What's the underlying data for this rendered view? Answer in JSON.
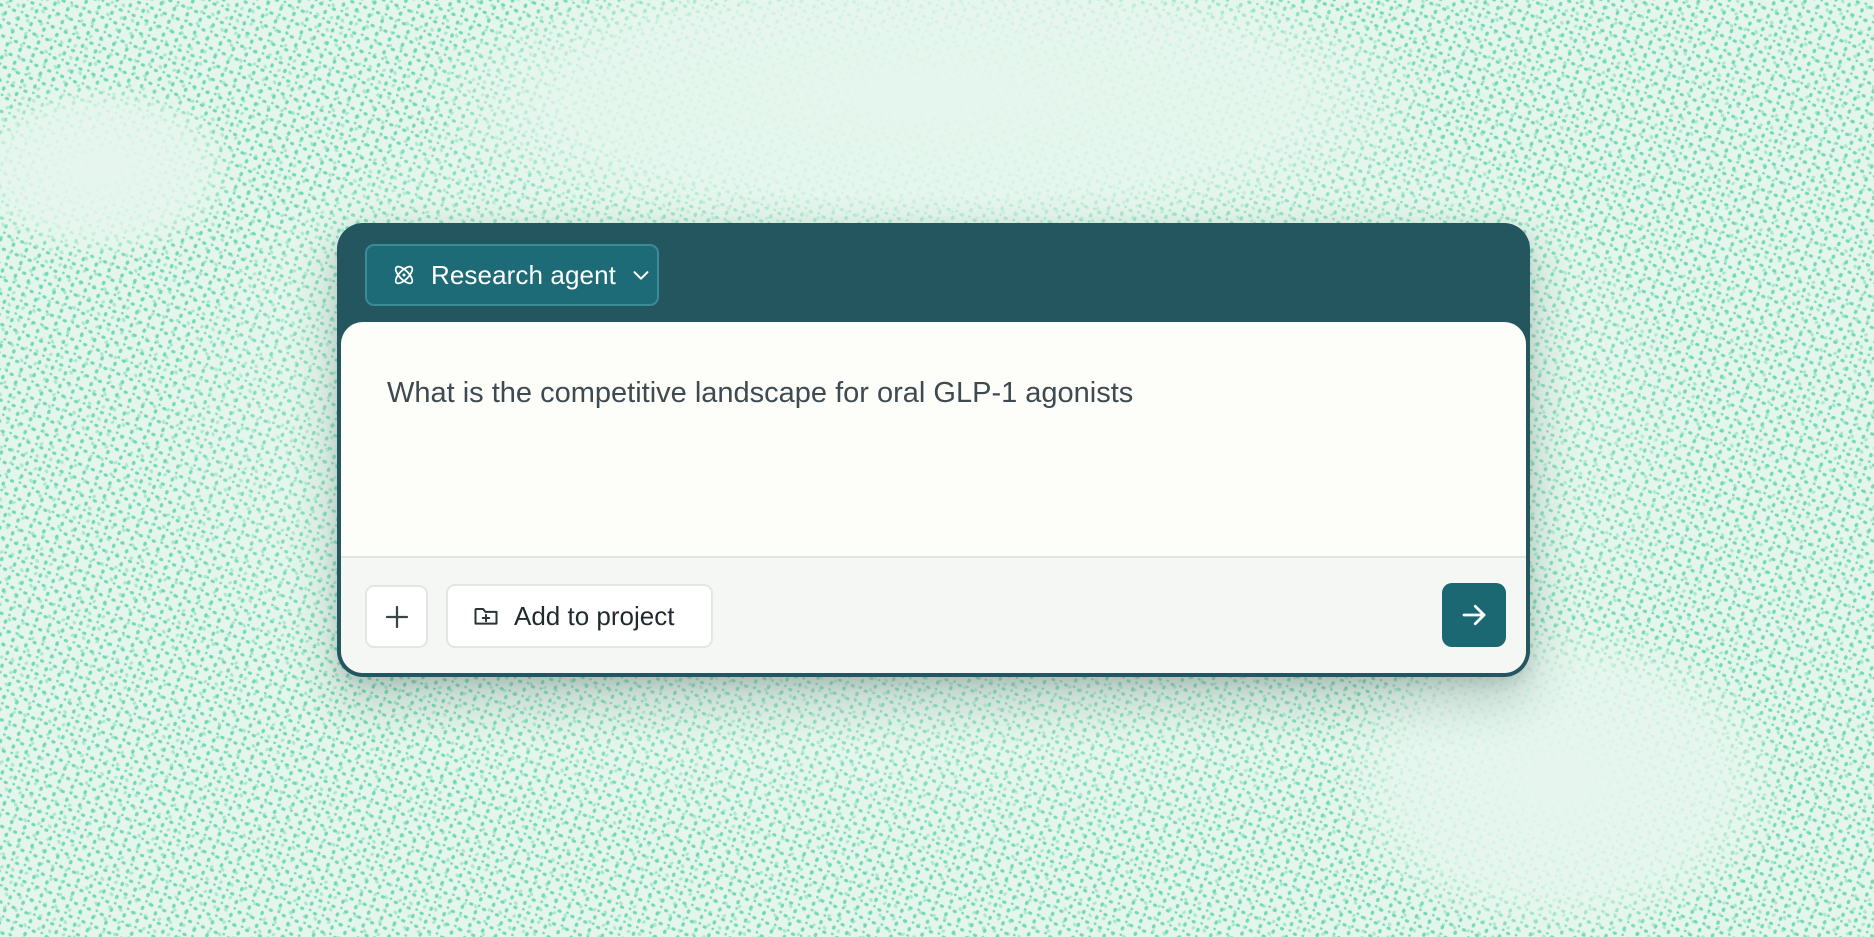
{
  "agent_selector": {
    "label": "Research agent",
    "icon": "atom-icon",
    "dropdown_icon": "chevron-down-icon"
  },
  "prompt": {
    "value": "What is the competitive landscape for oral GLP-1 agonists"
  },
  "footer": {
    "attach_icon": "plus-icon",
    "add_to_project_label": "Add to project",
    "add_to_project_icon": "folder-plus-icon",
    "send_icon": "arrow-right-icon"
  },
  "colors": {
    "background": "#e3f5ec",
    "dots": "#5fd6a4",
    "card_header": "#245660",
    "agent_button": "#1c6b76",
    "send_button": "#1b6772",
    "panel": "#fdfdf9",
    "footer": "#f5f7f5",
    "prompt_text": "#3e4a50"
  }
}
